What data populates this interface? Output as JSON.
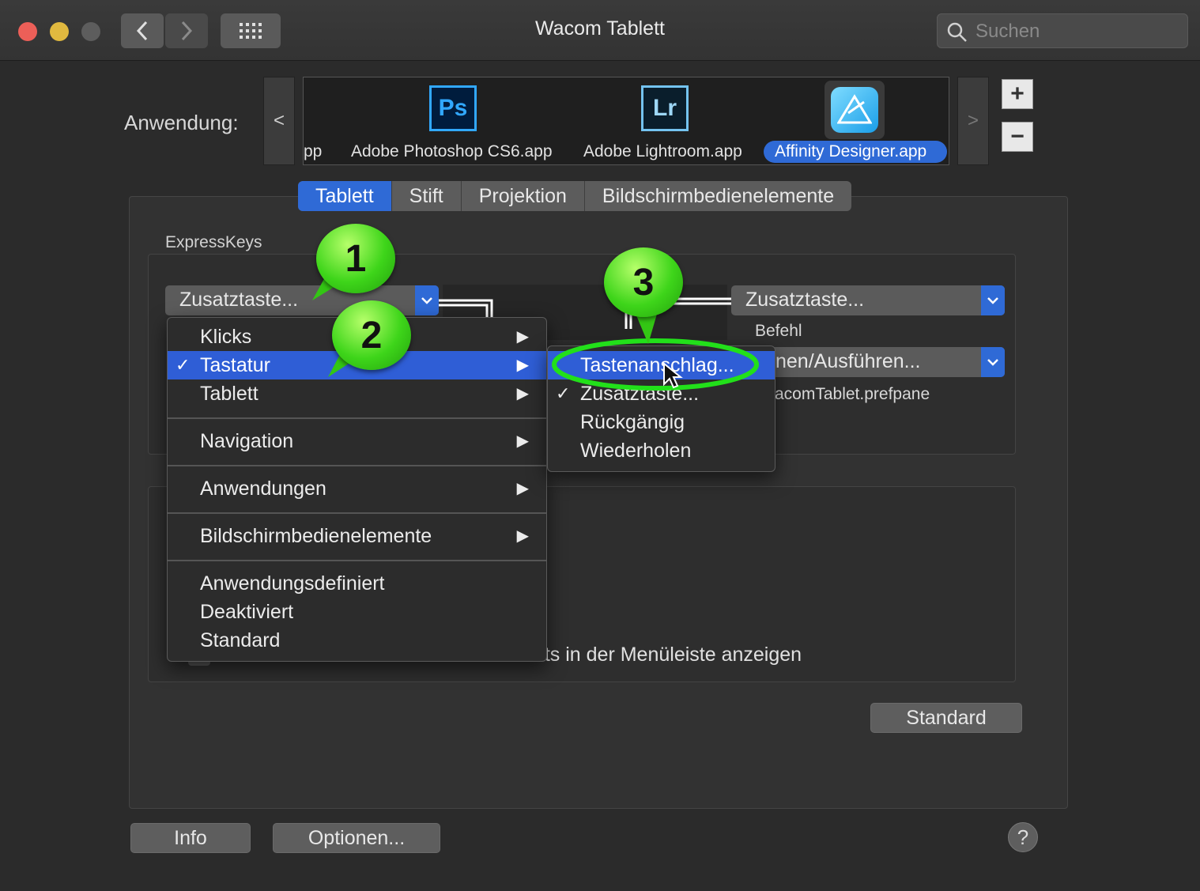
{
  "window": {
    "title": "Wacom Tablett"
  },
  "search": {
    "placeholder": "Suchen"
  },
  "app_picker": {
    "label": "Anwendung:",
    "scroll_left": "<",
    "scroll_right": ">",
    "apps": [
      {
        "name": "pp"
      },
      {
        "name": "Adobe Photoshop CS6.app",
        "icon": "Ps"
      },
      {
        "name": "Adobe Lightroom.app",
        "icon": "Lr"
      },
      {
        "name": "Affinity Designer.app",
        "selected": true
      }
    ],
    "add": "+",
    "remove": "−"
  },
  "tabs": [
    {
      "label": "Tablett",
      "active": true
    },
    {
      "label": "Stift"
    },
    {
      "label": "Projektion"
    },
    {
      "label": "Bildschirmbedienelemente"
    }
  ],
  "expresskeys": {
    "title": "ExpressKeys",
    "left_popup": "Zusatztaste...",
    "right_popup": "Zusatztaste...",
    "befehl_label": "Befehl",
    "command_popup": "nen/Ausführen...",
    "prefpane_text": "acomTablet.prefpane"
  },
  "lower_group": {
    "checkbox_text": "etts in der Menüleiste anzeigen"
  },
  "buttons": {
    "standard": "Standard",
    "info": "Info",
    "options": "Optionen...",
    "help": "?"
  },
  "menu": {
    "items": [
      {
        "label": "Klicks",
        "submenu": true
      },
      {
        "label": "Tastatur",
        "submenu": true,
        "checked": true,
        "highlighted": true
      },
      {
        "label": "Tablett",
        "submenu": true
      },
      {
        "label": "Navigation",
        "submenu": true
      },
      {
        "label": "Anwendungen",
        "submenu": true
      },
      {
        "label": "Bildschirmbedienelemente",
        "submenu": true
      },
      {
        "label": "Anwendungsdefiniert"
      },
      {
        "label": "Deaktiviert"
      },
      {
        "label": "Standard"
      }
    ],
    "check": "✓",
    "arrow": "▶"
  },
  "submenu": {
    "items": [
      {
        "label": "Tastenanschlag...",
        "highlighted": true
      },
      {
        "label": "Zusatztaste...",
        "checked": true
      },
      {
        "label": "Rückgängig"
      },
      {
        "label": "Wiederholen"
      }
    ]
  },
  "callouts": [
    "1",
    "2",
    "3"
  ],
  "colors": {
    "accent": "#2f6ad6",
    "callout_green": "#3ed51a",
    "highlight_ring": "#22e01a"
  }
}
